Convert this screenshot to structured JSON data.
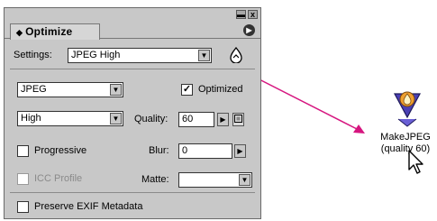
{
  "palette": {
    "tab_label": "Optimize",
    "window_buttons": {
      "minimize": "▬",
      "close": "x"
    },
    "menu_button": "▶"
  },
  "settings": {
    "label": "Settings:",
    "value": "JPEG High"
  },
  "format": {
    "value": "JPEG"
  },
  "optimized": {
    "label": "Optimized",
    "checked": true,
    "mark": "✓"
  },
  "quality_preset": {
    "value": "High"
  },
  "quality": {
    "label": "Quality:",
    "value": "60"
  },
  "progressive": {
    "label": "Progressive",
    "checked": false
  },
  "blur": {
    "label": "Blur:",
    "value": "0"
  },
  "icc_profile": {
    "label": "ICC Profile",
    "checked": false,
    "disabled": true
  },
  "matte": {
    "label": "Matte:",
    "value": ""
  },
  "preserve_exif": {
    "label": "Preserve EXIF Metadata",
    "checked": false
  },
  "desktop_droplet": {
    "name": "MakeJPEG",
    "subtitle": "(quality 60)"
  },
  "colors": {
    "panel_bg": "#c8c8c8",
    "arrow": "#d6157f",
    "droplet_blue": "#4a3fb5",
    "droplet_orange": "#f0a030"
  },
  "icons": {
    "droplet": "droplet-icon",
    "cursor": "arrow-cursor-icon"
  }
}
